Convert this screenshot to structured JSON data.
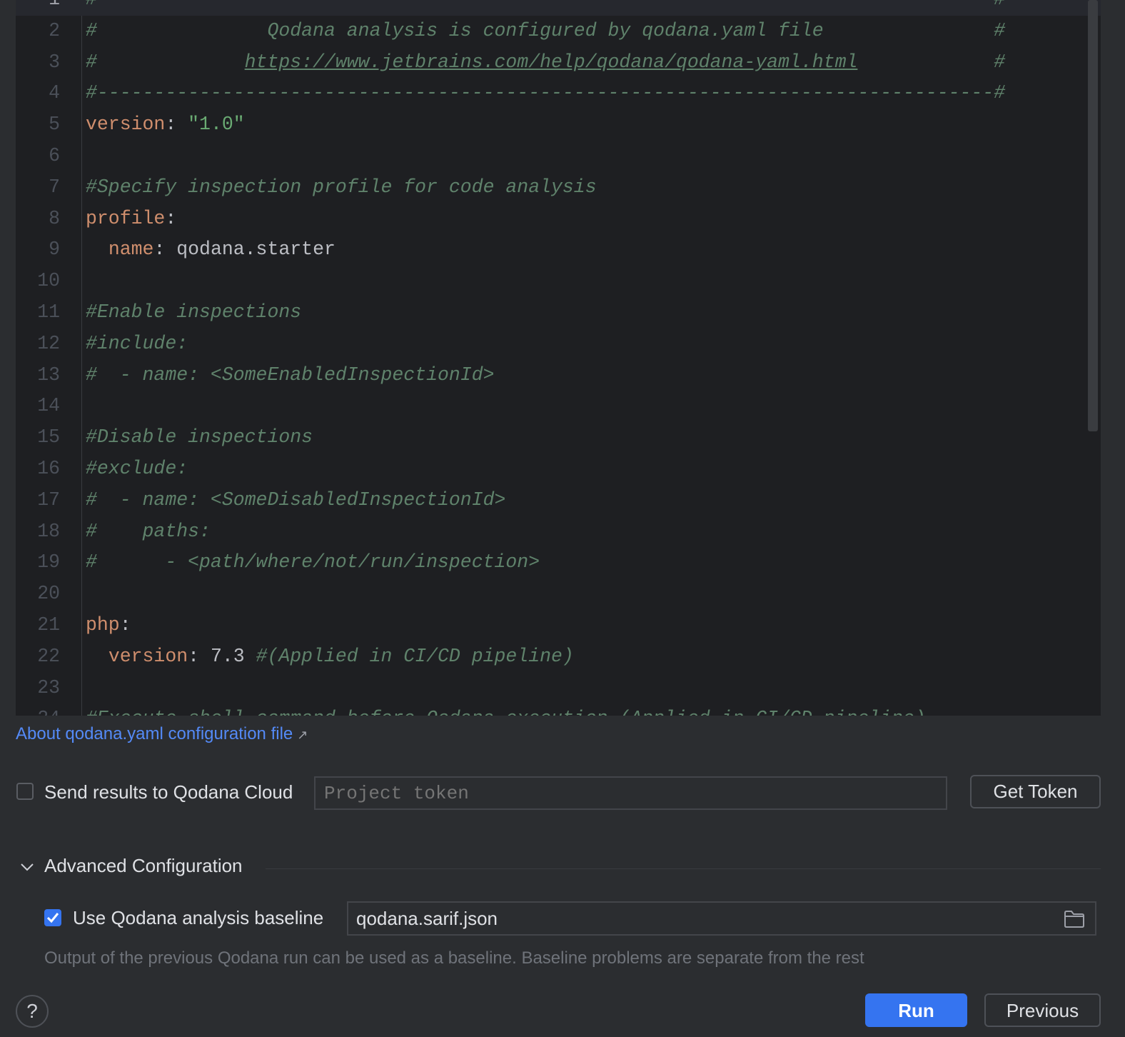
{
  "editor": {
    "lines": [
      [
        [
          "comment",
          "#-------------------------------------------------------------------------------#"
        ]
      ],
      [
        [
          "comment",
          "#               Qodana analysis is configured by qodana.yaml file               #"
        ]
      ],
      [
        [
          "comment",
          "#             "
        ],
        [
          "link",
          "https://www.jetbrains.com/help/qodana/qodana-yaml.html"
        ],
        [
          "comment",
          "            #"
        ]
      ],
      [
        [
          "comment",
          "#-------------------------------------------------------------------------------#"
        ]
      ],
      [
        [
          "key",
          "version"
        ],
        [
          "plain",
          ": "
        ],
        [
          "str",
          "\"1.0\""
        ]
      ],
      [],
      [
        [
          "comment",
          "#Specify inspection profile for code analysis"
        ]
      ],
      [
        [
          "key",
          "profile"
        ],
        [
          "plain",
          ":"
        ]
      ],
      [
        [
          "plain",
          "  "
        ],
        [
          "key",
          "name"
        ],
        [
          "plain",
          ": qodana.starter"
        ]
      ],
      [],
      [
        [
          "comment",
          "#Enable inspections"
        ]
      ],
      [
        [
          "comment",
          "#include:"
        ]
      ],
      [
        [
          "comment",
          "#  - name: <SomeEnabledInspectionId>"
        ]
      ],
      [],
      [
        [
          "comment",
          "#Disable inspections"
        ]
      ],
      [
        [
          "comment",
          "#exclude:"
        ]
      ],
      [
        [
          "comment",
          "#  - name: <SomeDisabledInspectionId>"
        ]
      ],
      [
        [
          "comment",
          "#    paths:"
        ]
      ],
      [
        [
          "comment",
          "#      - <path/where/not/run/inspection>"
        ]
      ],
      [],
      [
        [
          "key",
          "php"
        ],
        [
          "plain",
          ":"
        ]
      ],
      [
        [
          "plain",
          "  "
        ],
        [
          "key",
          "version"
        ],
        [
          "plain",
          ": 7.3 "
        ],
        [
          "comment",
          "#(Applied in CI/CD pipeline)"
        ]
      ],
      [],
      [
        [
          "comment",
          "#Execute shell command before Qodana execution (Applied in CI/CD pipeline)"
        ]
      ]
    ]
  },
  "about_link": "About qodana.yaml configuration file",
  "about_link_icon": "↗",
  "cloud": {
    "checkbox_label": "Send results to Qodana Cloud",
    "checked": false,
    "token_placeholder": "Project token",
    "get_token": "Get Token"
  },
  "advanced": {
    "title": "Advanced Configuration",
    "baseline_label": "Use Qodana analysis baseline",
    "baseline_checked": true,
    "baseline_value": "qodana.sarif.json",
    "hint": "Output of the previous Qodana run can be used as a baseline. Baseline problems are separate from the rest"
  },
  "buttons": {
    "help": "?",
    "run": "Run",
    "previous": "Previous"
  },
  "colors": {
    "accent": "#3574f0",
    "link": "#548af7"
  }
}
